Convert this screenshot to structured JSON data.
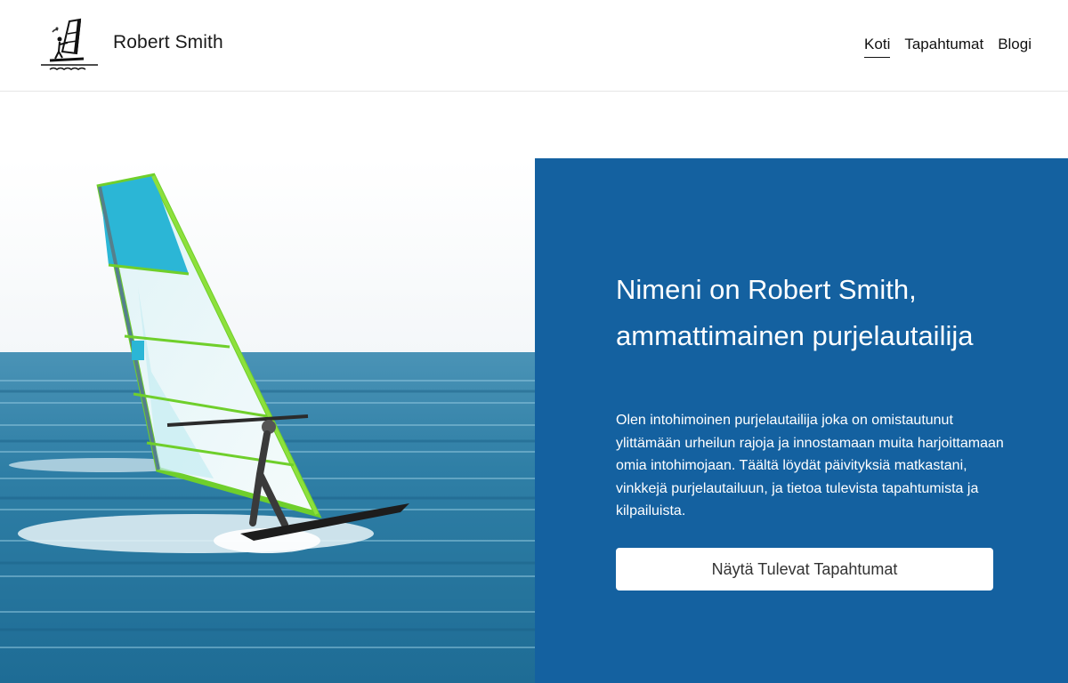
{
  "header": {
    "site_title": "Robert Smith",
    "logo_icon": "windsurfer-logo-icon",
    "nav": [
      {
        "label": "Koti",
        "active": true
      },
      {
        "label": "Tapahtumat",
        "active": false
      },
      {
        "label": "Blogi",
        "active": false
      }
    ]
  },
  "hero": {
    "image_icon": "windsurfer-photo",
    "heading": "Nimeni on Robert Smith, ammattimainen purjelautailija",
    "body": "Olen intohimoinen purjelautailija joka on omistautunut ylittämään urheilun rajoja ja innostamaan muita harjoittamaan omia intohimojaan. Täältä löydät päivityksiä matkastani, vinkkejä purjelautailuun, ja tietoa tulevista tapahtumista ja kilpailuista.",
    "button_label": "Näytä Tulevat Tapahtumat",
    "panel_color": "#1461a0"
  }
}
